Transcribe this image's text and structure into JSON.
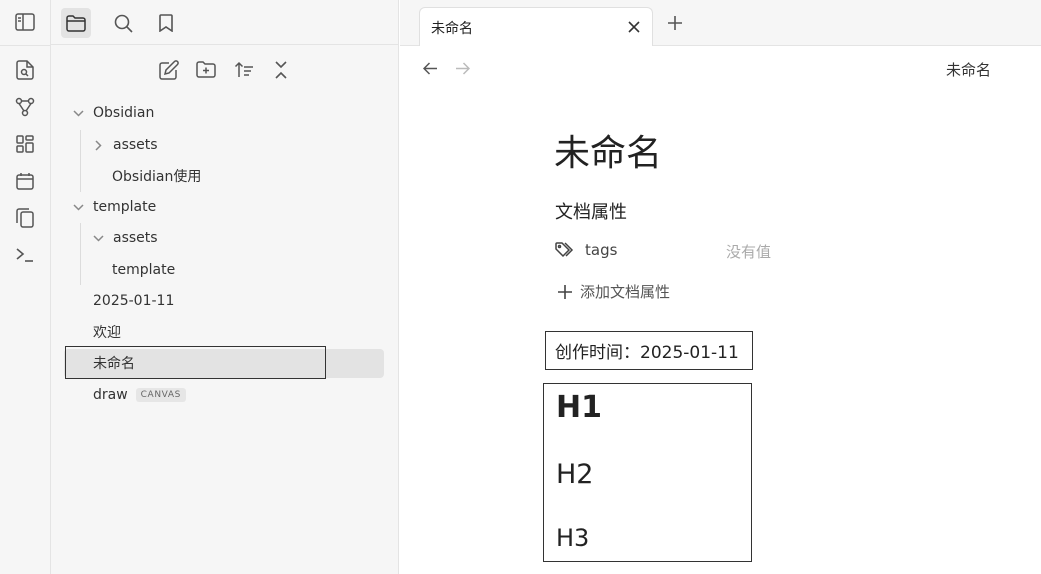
{
  "ribbon": {
    "icons": [
      "sidebar-toggle-icon",
      "open-quick-switcher-icon",
      "graph-view-icon",
      "canvas-icon",
      "daily-note-icon",
      "templates-icon",
      "command-palette-icon"
    ]
  },
  "sidebar": {
    "tabs": [
      "files-icon",
      "search-icon",
      "bookmarks-icon"
    ],
    "nav_buttons": [
      "new-note-icon",
      "new-folder-icon",
      "sort-icon",
      "collapse-all-icon"
    ],
    "tree": [
      {
        "label": "Obsidian"
      },
      {
        "label": "assets"
      },
      {
        "label": "Obsidian使用"
      },
      {
        "label": "template"
      },
      {
        "label": "assets"
      },
      {
        "label": "template"
      },
      {
        "label": "2025-01-11"
      },
      {
        "label": "欢迎"
      },
      {
        "label": "未命名"
      },
      {
        "label": "draw",
        "badge": "CANVAS"
      }
    ]
  },
  "tabs": [
    {
      "title": "未命名"
    }
  ],
  "view_header": {
    "title": "未命名"
  },
  "document": {
    "title": "未命名",
    "properties_heading": "文档属性",
    "property": {
      "key": "tags",
      "value_placeholder": "没有值"
    },
    "add_property": "添加文档属性",
    "created_line": "创作时间：2025-01-11",
    "h1": "H1",
    "h2": "H2",
    "h3": "H3"
  },
  "colors": {
    "sidebar_bg": "#f6f6f6",
    "active_bg": "#e3e3e3",
    "text": "#222222",
    "muted": "#aaaaaa"
  }
}
